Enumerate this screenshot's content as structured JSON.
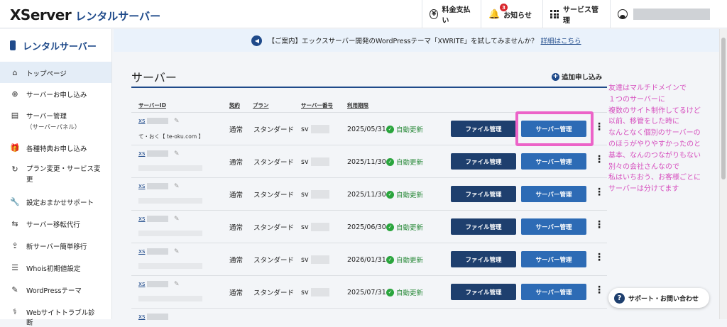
{
  "header": {
    "logo_main": "XServer",
    "logo_sub": "レンタルサーバー",
    "payment_label": "料金支払い",
    "notice_label": "お知らせ",
    "notice_count": "3",
    "service_label": "サービス管理"
  },
  "notice": {
    "text": "【ご案内】エックスサーバー開発のWordPressテーマ「XWRITE」を試してみませんか？",
    "link": "詳細はこちら"
  },
  "sidebar": {
    "title": "レンタルサーバー",
    "items": [
      {
        "label": "トップページ",
        "icon": "home-icon"
      },
      {
        "label": "サーバーお申し込み",
        "icon": "plus-circle-icon"
      },
      {
        "label": "サーバー管理",
        "sub": "（サーバーパネル）",
        "icon": "server-icon"
      },
      {
        "label": "各種特典お申し込み",
        "icon": "gift-icon"
      },
      {
        "label": "プラン変更・サービス変更",
        "icon": "refresh-icon"
      },
      {
        "label": "設定おまかせサポート",
        "icon": "wrench-icon"
      },
      {
        "label": "サーバー移転代行",
        "icon": "transfer-icon"
      },
      {
        "label": "新サーバー簡単移行",
        "icon": "upload-icon"
      },
      {
        "label": "Whois初期値設定",
        "icon": "document-icon"
      },
      {
        "label": "WordPressテーマ",
        "icon": "edit-icon"
      },
      {
        "label": "Webサイトトラブル診断",
        "icon": "stethoscope-icon"
      }
    ]
  },
  "main": {
    "title": "サーバー",
    "add_label": "追加申し込み",
    "columns": [
      "サーバーID",
      "契約",
      "プラン",
      "サーバー番号",
      "利用期限"
    ],
    "file_btn": "ファイル管理",
    "server_btn": "サーバー管理",
    "rows": [
      {
        "id": "xs",
        "memo": "て・おく【 te-oku.com 】",
        "contract": "通常",
        "plan": "スタンダード",
        "sv": "sv",
        "expiry": "2025/05/31",
        "renew": "自動更新"
      },
      {
        "id": "xs",
        "memo": "",
        "contract": "通常",
        "plan": "スタンダード",
        "sv": "sv",
        "expiry": "2025/11/30",
        "renew": "自動更新"
      },
      {
        "id": "xs",
        "memo": "",
        "contract": "通常",
        "plan": "スタンダード",
        "sv": "sv",
        "expiry": "2025/11/30",
        "renew": "自動更新"
      },
      {
        "id": "xs",
        "memo": "",
        "contract": "通常",
        "plan": "スタンダード",
        "sv": "sv",
        "expiry": "2025/06/30",
        "renew": "自動更新"
      },
      {
        "id": "xs",
        "memo": "",
        "contract": "通常",
        "plan": "スタンダード",
        "sv": "sv",
        "expiry": "2026/01/31",
        "renew": "自動更新"
      },
      {
        "id": "xs",
        "memo": "",
        "contract": "通常",
        "plan": "スタンダード",
        "sv": "sv",
        "expiry": "2025/07/31",
        "renew": "自動更新"
      },
      {
        "id": "xs",
        "memo": "",
        "contract": "",
        "plan": "",
        "sv": "",
        "expiry": "",
        "renew": ""
      }
    ]
  },
  "annotation": {
    "lines": [
      "友達はマルチドメインで",
      "１つのサーバーに",
      "複数のサイト制作してるけど",
      "以前、移管をした時に",
      "なんとなく個別のサーバーの",
      "のほうがやりやすかったのと",
      "基本、なんのつながりもない",
      "別々の会社さんなので",
      "私はいちおう、お客様ごとに",
      "サーバーは分けてます"
    ],
    "color": "#d64fbe"
  },
  "support": {
    "label": "サポート・お問い合わせ"
  },
  "colors": {
    "brand": "#1f4a8a",
    "file_button": "#1e3f6e",
    "server_button": "#2d6bb5",
    "highlight": "#ec63c8",
    "renew": "#2aa53d"
  }
}
